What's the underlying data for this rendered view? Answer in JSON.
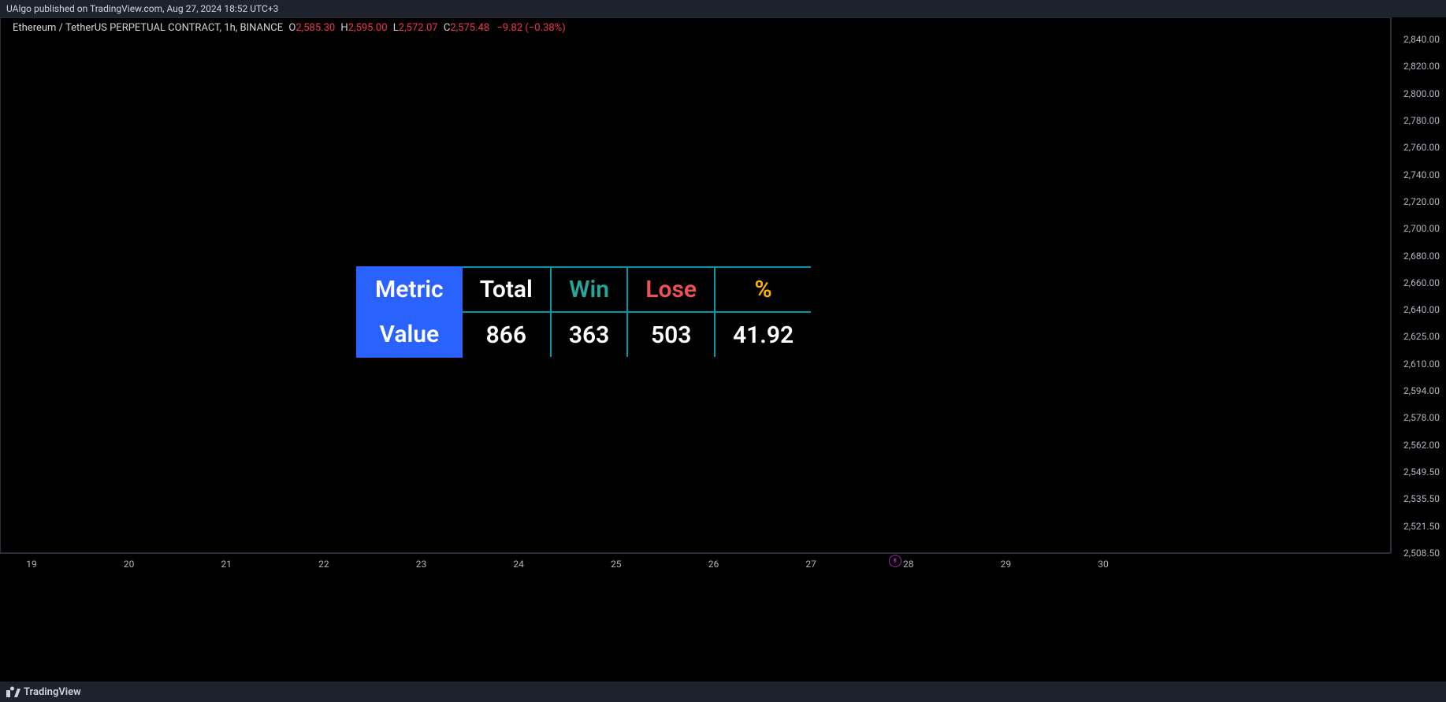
{
  "top_bar": {
    "publish_text": "UAlgo published on TradingView.com, Aug 27, 2024 18:52 UTC+3"
  },
  "symbol": {
    "name": "Ethereum / TetherUS PERPETUAL CONTRACT, 1h, BINANCE",
    "o_label": "O",
    "o_value": "2,585.30",
    "h_label": "H",
    "h_value": "2,595.00",
    "l_label": "L",
    "l_value": "2,572.07",
    "c_label": "C",
    "c_value": "2,575.48",
    "change": "−9.82 (−0.38%)"
  },
  "metrics": {
    "headers": {
      "metric": "Metric",
      "total": "Total",
      "win": "Win",
      "lose": "Lose",
      "pct": "%"
    },
    "row_label": "Value",
    "values": {
      "total": "866",
      "win": "363",
      "lose": "503",
      "pct": "41.92"
    }
  },
  "y_ticks": [
    "2,840.00",
    "2,820.00",
    "2,800.00",
    "2,780.00",
    "2,760.00",
    "2,740.00",
    "2,720.00",
    "2,700.00",
    "2,680.00",
    "2,660.00",
    "2,640.00",
    "2,625.00",
    "2,610.00",
    "2,594.00",
    "2,578.00",
    "2,562.00",
    "2,549.50",
    "2,535.50",
    "2,521.50",
    "2,508.50"
  ],
  "x_ticks": [
    "19",
    "20",
    "21",
    "22",
    "23",
    "24",
    "25",
    "26",
    "27",
    "28",
    "29",
    "30"
  ],
  "footer": {
    "brand": "TradingView"
  },
  "chart_data": {
    "type": "table",
    "title": "Backtest summary metrics",
    "columns": [
      "Total",
      "Win",
      "Lose",
      "%"
    ],
    "rows": [
      {
        "label": "Value",
        "values": [
          866,
          363,
          503,
          41.92
        ]
      }
    ],
    "price_axis_range": [
      2508.5,
      2840.0
    ],
    "time_axis_labels": [
      "19",
      "20",
      "21",
      "22",
      "23",
      "24",
      "25",
      "26",
      "27",
      "28",
      "29",
      "30"
    ],
    "ohlc": {
      "open": 2585.3,
      "high": 2595.0,
      "low": 2572.07,
      "close": 2575.48,
      "change": -9.82,
      "change_pct": -0.38
    }
  }
}
